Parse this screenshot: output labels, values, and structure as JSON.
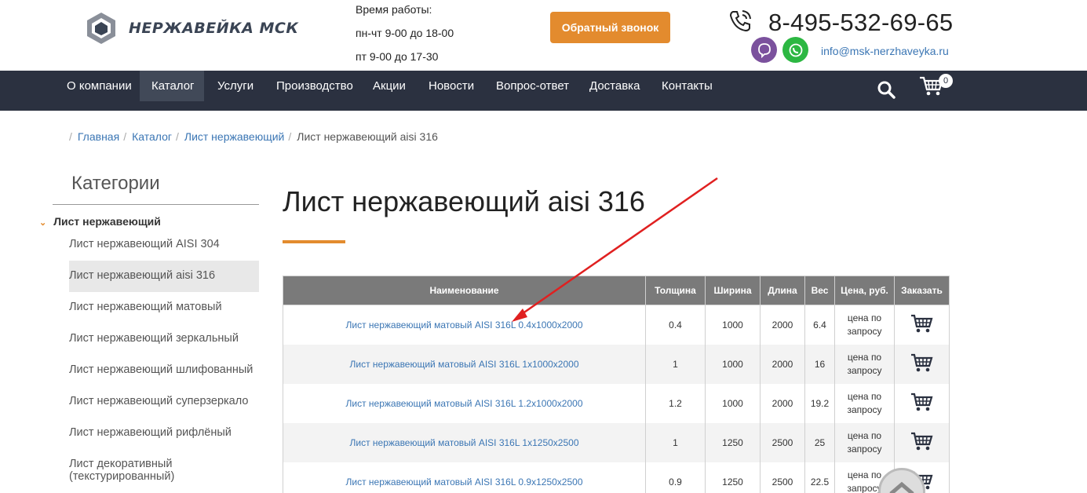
{
  "header": {
    "logo_text": "НЕРЖАВЕЙКА МСК",
    "hours": [
      "Время работы:",
      "пн-чт 9-00 до 18-00",
      "пт 9-00 до 17-30"
    ],
    "callback_label": "Обратный звонок",
    "phone": "8-495-532-69-65",
    "email": "info@msk-nerzhaveyka.ru"
  },
  "nav": {
    "items": [
      "О компании",
      "Каталог",
      "Услуги",
      "Производство",
      "Акции",
      "Новости",
      "Вопрос-ответ",
      "Доставка",
      "Контакты"
    ],
    "active": "Каталог",
    "cart_count": "0"
  },
  "breadcrumb": [
    "Главная",
    "Каталог",
    "Лист нержавеющий",
    "Лист нержавеющий aisi 316"
  ],
  "sidebar": {
    "title": "Категории",
    "group": "Лист нержавеющий",
    "items": [
      "Лист нержавеющий AISI 304",
      "Лист нержавеющий aisi 316",
      "Лист нержавеющий матовый",
      "Лист нержавеющий зеркальный",
      "Лист нержавеющий шлифованный",
      "Лист нержавеющий суперзеркало",
      "Лист нержавеющий рифлёный",
      "Лист декоративный",
      "(текстурированный)"
    ],
    "active": "Лист нержавеющий aisi 316"
  },
  "main": {
    "title": "Лист нержавеющий aisi 316",
    "columns": [
      "Наименование",
      "Толщина",
      "Ширина",
      "Длина",
      "Вес",
      "Цена, руб.",
      "Заказать"
    ],
    "rows": [
      {
        "name": "Лист нержавеющий матовый AISI 316L 0.4x1000x2000",
        "thickness": "0.4",
        "width": "1000",
        "length": "2000",
        "weight": "6.4",
        "price1": "цена по",
        "price2": "запросу"
      },
      {
        "name": "Лист нержавеющий матовый AISI 316L 1x1000x2000",
        "thickness": "1",
        "width": "1000",
        "length": "2000",
        "weight": "16",
        "price1": "цена по",
        "price2": "запросу"
      },
      {
        "name": "Лист нержавеющий матовый AISI 316L 1.2x1000x2000",
        "thickness": "1.2",
        "width": "1000",
        "length": "2000",
        "weight": "19.2",
        "price1": "цена по",
        "price2": "запросу"
      },
      {
        "name": "Лист нержавеющий матовый AISI 316L 1x1250x2500",
        "thickness": "1",
        "width": "1250",
        "length": "2500",
        "weight": "25",
        "price1": "цена по",
        "price2": "запросу"
      },
      {
        "name": "Лист нержавеющий матовый AISI 316L 0.9x1250x2500",
        "thickness": "0.9",
        "width": "1250",
        "length": "2500",
        "weight": "22.5",
        "price1": "цена по",
        "price2": "запросу"
      }
    ]
  },
  "colors": {
    "accent": "#e38b2e",
    "nav_bg": "#2b3140",
    "link": "#3b76b4",
    "table_head": "#7a7a7a",
    "arrow": "#e02020"
  }
}
